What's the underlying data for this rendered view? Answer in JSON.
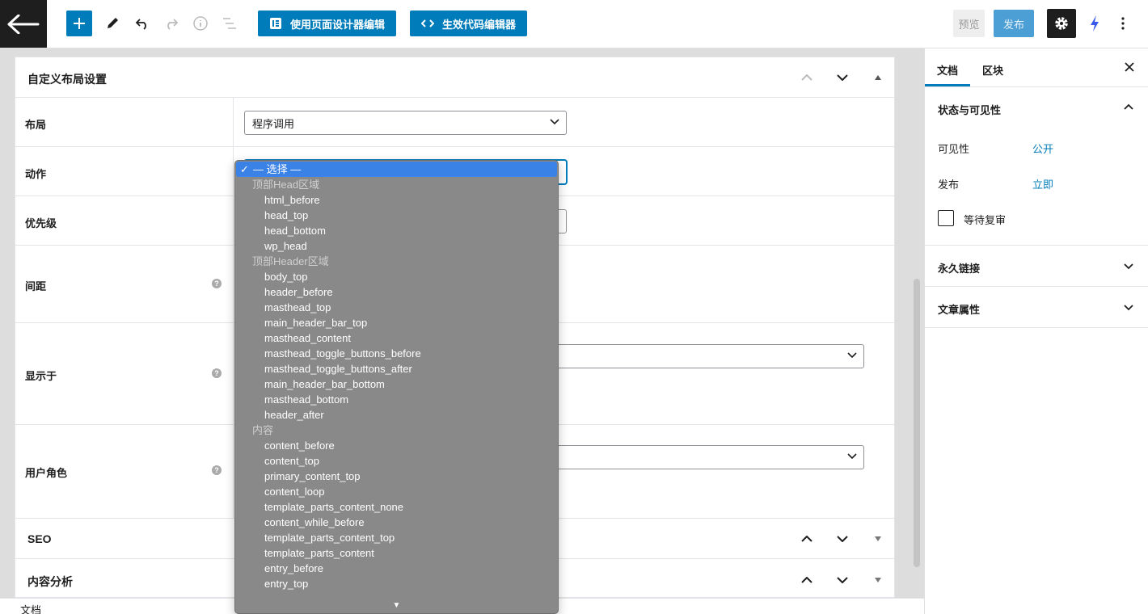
{
  "toolbar": {
    "design_button": "使用页面设计器编辑",
    "code_button": "生效代码编辑器",
    "preview": "预览",
    "publish": "发布"
  },
  "panel": {
    "title": "自定义布局设置",
    "rows": {
      "layout": {
        "label": "布局",
        "value": "程序调用"
      },
      "action": {
        "label": "动作"
      },
      "priority": {
        "label": "优先级"
      },
      "spacing": {
        "label": "间距"
      },
      "display_on": {
        "label": "显示于"
      },
      "user_role": {
        "label": "用户角色"
      }
    }
  },
  "meta_boxes": {
    "seo": "SEO",
    "content_analysis": "内容分析"
  },
  "footer": {
    "text": "文档"
  },
  "sidebar": {
    "tabs": {
      "document": "文档",
      "block": "区块"
    },
    "status": {
      "title": "状态与可见性",
      "visibility_label": "可见性",
      "visibility_value": "公开",
      "publish_label": "发布",
      "publish_value": "立即",
      "pending_review": "等待复审"
    },
    "permalink": "永久链接",
    "post_attributes": "文章属性"
  },
  "dropdown": {
    "selected": "— 选择 —",
    "groups": [
      {
        "label": "顶部Head区域",
        "options": [
          "html_before",
          "head_top",
          "head_bottom",
          "wp_head"
        ]
      },
      {
        "label": "顶部Header区域",
        "options": [
          "body_top",
          "header_before",
          "masthead_top",
          "main_header_bar_top",
          "masthead_content",
          "masthead_toggle_buttons_before",
          "masthead_toggle_buttons_after",
          "main_header_bar_bottom",
          "masthead_bottom",
          "header_after"
        ]
      },
      {
        "label": "内容",
        "options": [
          "content_before",
          "content_top",
          "primary_content_top",
          "content_loop",
          "template_parts_content_none",
          "content_while_before",
          "template_parts_content_top",
          "template_parts_content",
          "entry_before",
          "entry_top"
        ]
      }
    ]
  },
  "colors": {
    "accent": "#007cba",
    "dark": "#1e1e1e",
    "dropdown_bg": "#898989",
    "highlight": "#3b82e6"
  }
}
